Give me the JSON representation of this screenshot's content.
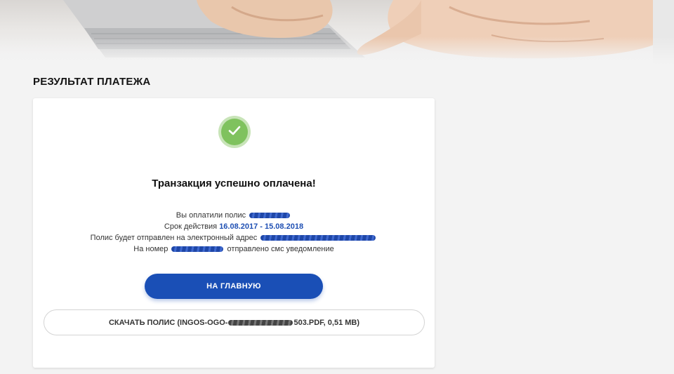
{
  "page_title": "РЕЗУЛЬТАТ ПЛАТЕЖА",
  "result": {
    "title": "Транзакция успешно оплачена!",
    "line1_label": "Вы оплатили полис",
    "line2_label": "Срок действия",
    "validity_period": "16.08.2017 - 15.08.2018",
    "line3_label": "Полис будет отправлен на электронный адрес",
    "line4_prefix": "На номер",
    "line4_suffix": "отправлено смс уведомление"
  },
  "buttons": {
    "home": "НА ГЛАВНУЮ",
    "download_prefix": "СКАЧАТЬ ПОЛИС (INGOS-OGO-",
    "download_suffix": "503.PDF, 0,51 MB)"
  },
  "icons": {
    "success": "check-icon"
  },
  "colors": {
    "accent_blue": "#1a4fb6",
    "success_green": "#7fc25e",
    "background": "#f3f3f3"
  }
}
